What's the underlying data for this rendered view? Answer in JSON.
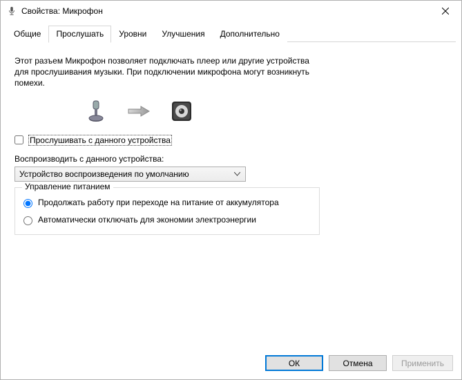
{
  "window": {
    "title": "Свойства: Микрофон"
  },
  "tabs": {
    "items": [
      {
        "label": "Общие"
      },
      {
        "label": "Прослушать"
      },
      {
        "label": "Уровни"
      },
      {
        "label": "Улучшения"
      },
      {
        "label": "Дополнительно"
      }
    ],
    "active_index": 1
  },
  "content": {
    "description": "Этот разъем Микрофон позволяет подключать плеер или другие устройства для прослушивания музыки. При подключении микрофона могут возникнуть помехи.",
    "listen_checkbox_label": "Прослушивать с данного устройства",
    "listen_checked": false,
    "playback_label": "Воспроизводить с данного устройства:",
    "playback_selected": "Устройство воспроизведения по умолчанию",
    "power_group": {
      "legend": "Управление питанием",
      "option1": "Продолжать работу при переходе на питание от аккумулятора",
      "option2": "Автоматически отключать для экономии электроэнергии",
      "selected": 0
    }
  },
  "buttons": {
    "ok": "ОК",
    "cancel": "Отмена",
    "apply": "Применить"
  }
}
